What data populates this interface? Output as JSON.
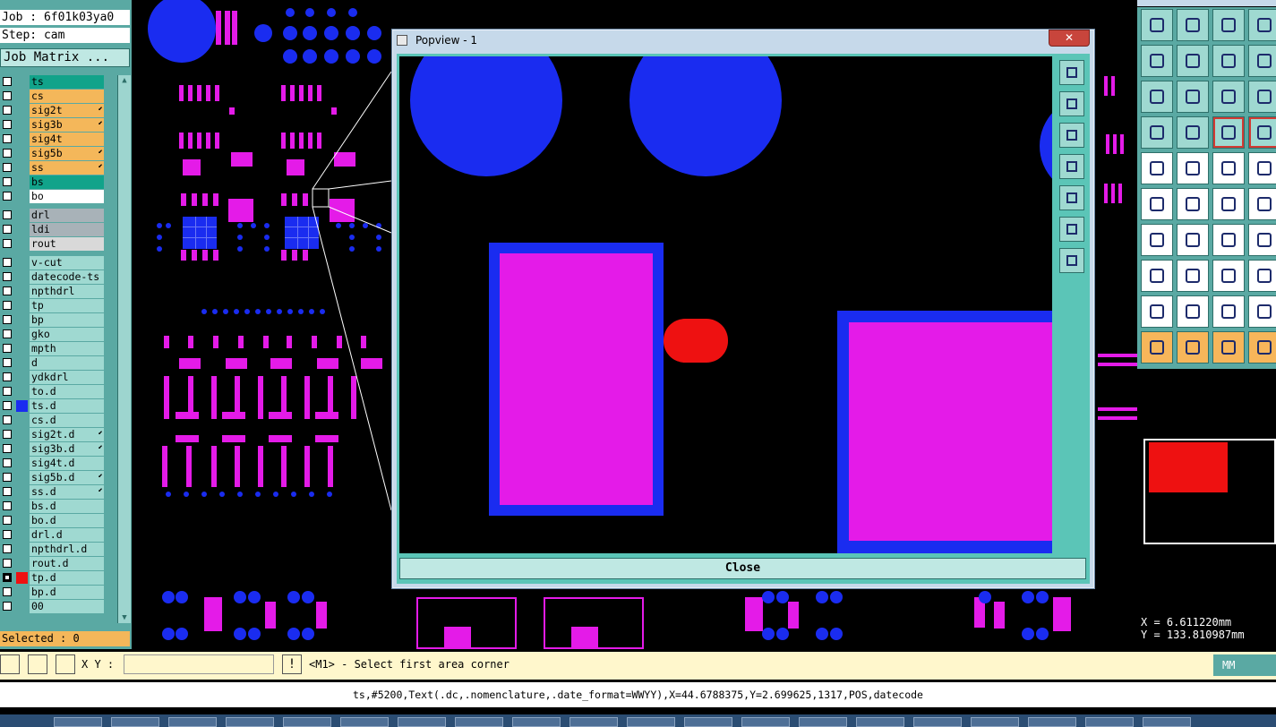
{
  "job": {
    "job_label": "Job : 6f01k03ya0",
    "step_label": "Step: cam",
    "matrix_button": "Job Matrix ..."
  },
  "layers": [
    {
      "name": "ts",
      "color": "#11a38a",
      "text": "#000",
      "swatch": "",
      "arrow": false,
      "checked": false
    },
    {
      "name": "cs",
      "color": "#f4b75a",
      "text": "#000",
      "swatch": "",
      "arrow": false,
      "checked": false
    },
    {
      "name": "sig2t",
      "color": "#f4b75a",
      "text": "#000",
      "swatch": "",
      "arrow": true,
      "checked": false
    },
    {
      "name": "sig3b",
      "color": "#f4b75a",
      "text": "#000",
      "swatch": "",
      "arrow": true,
      "checked": false
    },
    {
      "name": "sig4t",
      "color": "#f4b75a",
      "text": "#000",
      "swatch": "",
      "arrow": false,
      "checked": false
    },
    {
      "name": "sig5b",
      "color": "#f4b75a",
      "text": "#000",
      "swatch": "",
      "arrow": true,
      "checked": false
    },
    {
      "name": "ss",
      "color": "#f4b75a",
      "text": "#000",
      "swatch": "",
      "arrow": true,
      "checked": false
    },
    {
      "name": "bs",
      "color": "#11a38a",
      "text": "#000",
      "swatch": "",
      "arrow": false,
      "checked": false
    },
    {
      "name": "bo",
      "color": "#ffffff",
      "text": "#000",
      "swatch": "",
      "arrow": false,
      "checked": false
    },
    {
      "name": "drl",
      "color": "#a8b2b8",
      "text": "#000",
      "swatch": "",
      "arrow": false,
      "checked": false
    },
    {
      "name": "ldi",
      "color": "#a8b2b8",
      "text": "#000",
      "swatch": "",
      "arrow": false,
      "checked": false
    },
    {
      "name": "rout",
      "color": "#d9d9d9",
      "text": "#000",
      "swatch": "",
      "arrow": false,
      "checked": false
    },
    {
      "name": "v-cut",
      "color": "#9fd9d1",
      "text": "#000",
      "swatch": "",
      "arrow": false,
      "checked": false
    },
    {
      "name": "datecode-ts",
      "color": "#9fd9d1",
      "text": "#000",
      "swatch": "",
      "arrow": false,
      "checked": false
    },
    {
      "name": "npthdrl",
      "color": "#9fd9d1",
      "text": "#000",
      "swatch": "",
      "arrow": false,
      "checked": false
    },
    {
      "name": "tp",
      "color": "#9fd9d1",
      "text": "#000",
      "swatch": "",
      "arrow": false,
      "checked": false
    },
    {
      "name": "bp",
      "color": "#9fd9d1",
      "text": "#000",
      "swatch": "",
      "arrow": false,
      "checked": false
    },
    {
      "name": "gko",
      "color": "#9fd9d1",
      "text": "#000",
      "swatch": "",
      "arrow": false,
      "checked": false
    },
    {
      "name": "mpth",
      "color": "#9fd9d1",
      "text": "#000",
      "swatch": "",
      "arrow": false,
      "checked": false
    },
    {
      "name": "d",
      "color": "#9fd9d1",
      "text": "#000",
      "swatch": "",
      "arrow": false,
      "checked": false
    },
    {
      "name": "ydkdrl",
      "color": "#9fd9d1",
      "text": "#000",
      "swatch": "",
      "arrow": false,
      "checked": false
    },
    {
      "name": "to.d",
      "color": "#9fd9d1",
      "text": "#000",
      "swatch": "",
      "arrow": false,
      "checked": false
    },
    {
      "name": "ts.d",
      "color": "#9fd9d1",
      "text": "#000",
      "swatch": "#1a2cf0",
      "arrow": false,
      "checked": false
    },
    {
      "name": "cs.d",
      "color": "#9fd9d1",
      "text": "#000",
      "swatch": "",
      "arrow": false,
      "checked": false
    },
    {
      "name": "sig2t.d",
      "color": "#9fd9d1",
      "text": "#000",
      "swatch": "",
      "arrow": true,
      "checked": false
    },
    {
      "name": "sig3b.d",
      "color": "#9fd9d1",
      "text": "#000",
      "swatch": "",
      "arrow": true,
      "checked": false
    },
    {
      "name": "sig4t.d",
      "color": "#9fd9d1",
      "text": "#000",
      "swatch": "",
      "arrow": false,
      "checked": false
    },
    {
      "name": "sig5b.d",
      "color": "#9fd9d1",
      "text": "#000",
      "swatch": "",
      "arrow": true,
      "checked": false
    },
    {
      "name": "ss.d",
      "color": "#9fd9d1",
      "text": "#000",
      "swatch": "",
      "arrow": true,
      "checked": false
    },
    {
      "name": "bs.d",
      "color": "#9fd9d1",
      "text": "#000",
      "swatch": "",
      "arrow": false,
      "checked": false
    },
    {
      "name": "bo.d",
      "color": "#9fd9d1",
      "text": "#000",
      "swatch": "",
      "arrow": false,
      "checked": false
    },
    {
      "name": "drl.d",
      "color": "#9fd9d1",
      "text": "#000",
      "swatch": "",
      "arrow": false,
      "checked": false
    },
    {
      "name": "npthdrl.d",
      "color": "#9fd9d1",
      "text": "#000",
      "swatch": "",
      "arrow": false,
      "checked": false
    },
    {
      "name": "rout.d",
      "color": "#9fd9d1",
      "text": "#000",
      "swatch": "",
      "arrow": false,
      "checked": false
    },
    {
      "name": "tp.d",
      "color": "#9fd9d1",
      "text": "#000",
      "swatch": "#ee1111",
      "arrow": false,
      "checked": true
    },
    {
      "name": "bp.d",
      "color": "#9fd9d1",
      "text": "#000",
      "swatch": "",
      "arrow": false,
      "checked": false
    },
    {
      "name": "00",
      "color": "#9fd9d1",
      "text": "#000",
      "swatch": "",
      "arrow": false,
      "checked": false
    }
  ],
  "selected_label": "Selected : 0",
  "popup": {
    "title": "Popview - 1",
    "close_x": "✕",
    "close_button": "Close"
  },
  "coords": {
    "x": "X =   6.611220mm",
    "y": "Y = 133.810987mm"
  },
  "command": {
    "xy_label": "X Y :",
    "xy_value": "",
    "prompt": "<M1> - Select first area corner",
    "units": "MM"
  },
  "status_line": "ts,#5200,Text(.dc,.nomenclature,.date_format=WWYY),X=44.6788375,Y=2.699625,1317,POS,datecode",
  "colors": {
    "pad_magenta": "#e41be8",
    "pad_blue": "#1a2cf0",
    "highlight_red": "#ee1111",
    "panel_teal": "#5aa9a3",
    "panel_light": "#9fd9d1"
  },
  "icons": {
    "right_toolbar": [
      "zoom-home-icon",
      "zoom-fit-icon",
      "zoom-home2-icon",
      "zoom-corner-icon",
      "pan-left-icon",
      "pan-right-icon",
      "zoom-back-icon",
      "zoom-s-icon",
      "zoom-frame-icon",
      "zoom-center-icon",
      "zoom-1to1-icon",
      "help-icon",
      "measure-icon",
      "snap-icon",
      "layer-toggle-icon",
      "layer-swap-icon",
      "feature-add-icon",
      "feature-draw-icon",
      "ruler-icon",
      "pad-icon",
      "node-icon",
      "cross-icon",
      "arrow-node-icon",
      "arrow-node2-icon",
      "line-icon",
      "line-blue-icon",
      "arc-icon",
      "text-icon",
      "move-pad-icon",
      "line-cut-icon",
      "stretch-icon",
      "shape-icon",
      "angle-icon",
      "triangle-icon",
      "triangle2-icon",
      "triangle3-icon",
      "select-arrow-icon",
      "select-box-icon",
      "select-area-icon",
      "select-route-icon"
    ],
    "popup_toolbar": [
      "view-zoom-icon",
      "view-top-icon",
      "view-bottom-icon",
      "view-left-icon",
      "view-right-icon",
      "view-fit-icon",
      "view-center-icon"
    ]
  }
}
